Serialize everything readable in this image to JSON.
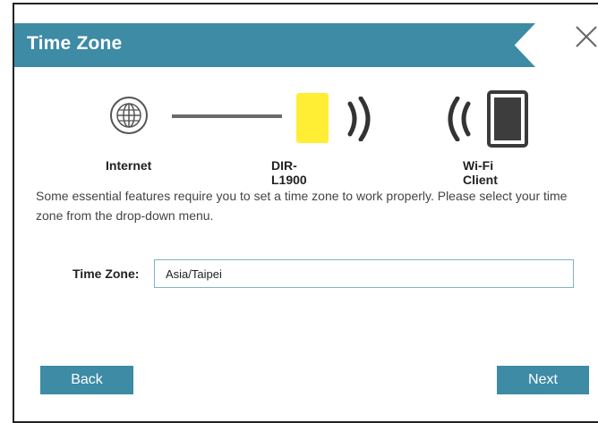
{
  "dialog": {
    "title": "Time Zone",
    "close_icon": "close-icon"
  },
  "diagram": {
    "internet": {
      "label": "Internet",
      "icon": "globe-icon"
    },
    "router": {
      "label": "DIR-L1900",
      "icon": "router-icon",
      "color": "#ffee33"
    },
    "client": {
      "label": "Wi-Fi Client",
      "icon": "phone-icon"
    }
  },
  "description": "Some essential features require you to set a time zone to work properly. Please select your time zone from the drop-down menu.",
  "time_zone": {
    "label": "Time Zone:",
    "value": "Asia/Taipei"
  },
  "buttons": {
    "back": "Back",
    "next": "Next"
  },
  "colors": {
    "accent": "#3d8ba5",
    "input_border": "#7fb3c6"
  }
}
